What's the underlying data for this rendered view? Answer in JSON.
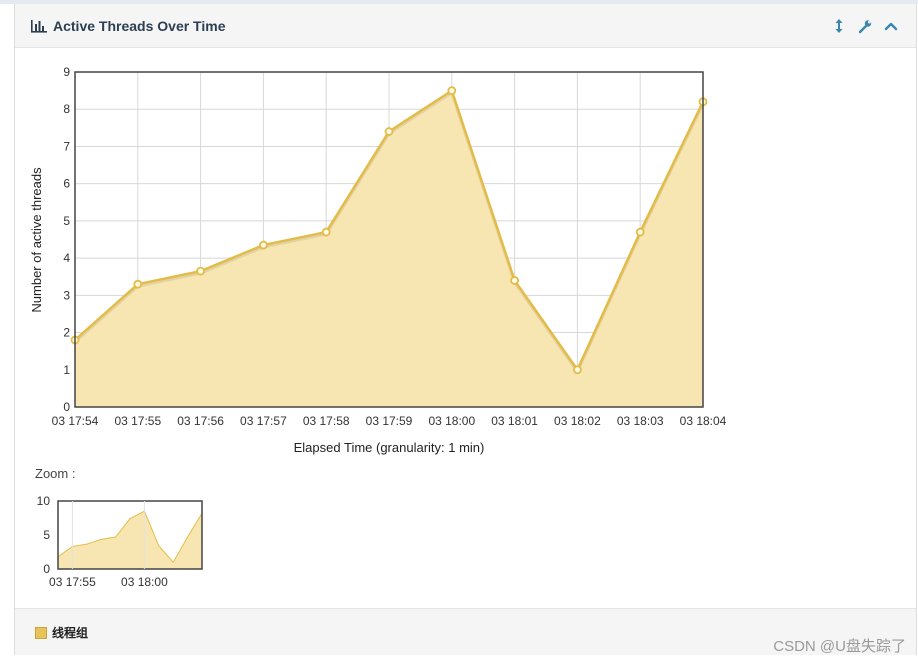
{
  "panel": {
    "title": "Active Threads Over Time",
    "zoom_label": "Zoom :",
    "legend_label": "线程组"
  },
  "watermark": "CSDN @U盘失踪了",
  "icons": {
    "title": "bar-chart-icon",
    "tools": [
      "resize-vertical-icon",
      "wrench-icon",
      "chevron-up-icon"
    ]
  },
  "colors": {
    "series_line": "#e3bc47",
    "series_fill": "#f7e5b2",
    "tool_icon": "#3a87ad"
  },
  "chart_data": {
    "type": "area",
    "xlabel": "Elapsed Time (granularity: 1 min)",
    "ylabel": "Number of active threads",
    "x": [
      "03 17:54",
      "03 17:55",
      "03 17:56",
      "03 17:57",
      "03 17:58",
      "03 17:59",
      "03 18:00",
      "03 18:01",
      "03 18:02",
      "03 18:03",
      "03 18:04"
    ],
    "series": [
      {
        "name": "线程组",
        "values": [
          1.8,
          3.3,
          3.65,
          4.35,
          4.7,
          7.4,
          8.5,
          3.4,
          1.0,
          4.7,
          8.2
        ]
      }
    ],
    "ylim": [
      0,
      9
    ],
    "yticks": [
      0,
      1,
      2,
      3,
      4,
      5,
      6,
      7,
      8,
      9
    ],
    "grid": true,
    "legend": "bottom-left",
    "zoom": {
      "ylim": [
        0,
        10
      ],
      "yticks": [
        0,
        5,
        10
      ],
      "xticks": [
        "03 17:55",
        "03 18:00"
      ]
    }
  }
}
